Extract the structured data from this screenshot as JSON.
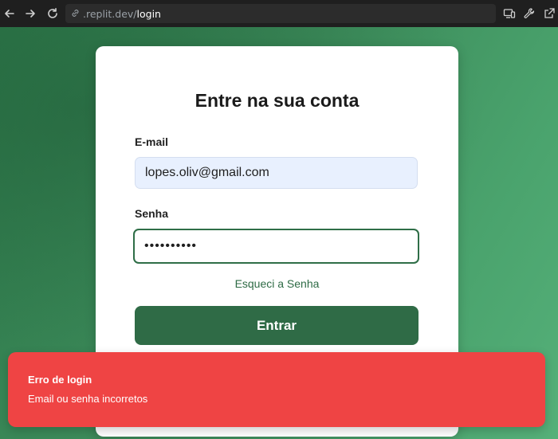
{
  "browser": {
    "url_host": ".replit.dev/",
    "url_path": "login",
    "icons": [
      "back-arrow-icon",
      "forward-arrow-icon",
      "reload-icon",
      "link-icon",
      "devices-icon",
      "wrench-icon",
      "open-external-icon"
    ]
  },
  "login": {
    "title": "Entre na sua conta",
    "email_label": "E-mail",
    "email_value": "lopes.oliv@gmail.com",
    "password_label": "Senha",
    "password_masked": "••••••••••",
    "forgot_link": "Esqueci a Senha",
    "submit_label": "Entrar"
  },
  "toast": {
    "title": "Erro de login",
    "message": "Email ou senha incorretos"
  },
  "colors": {
    "primary": "#2f6b46",
    "toast_bg": "#ef4444",
    "email_autofill_bg": "#e8f0fe",
    "background_gradient": [
      "#2f7b4c",
      "#55b079"
    ]
  }
}
